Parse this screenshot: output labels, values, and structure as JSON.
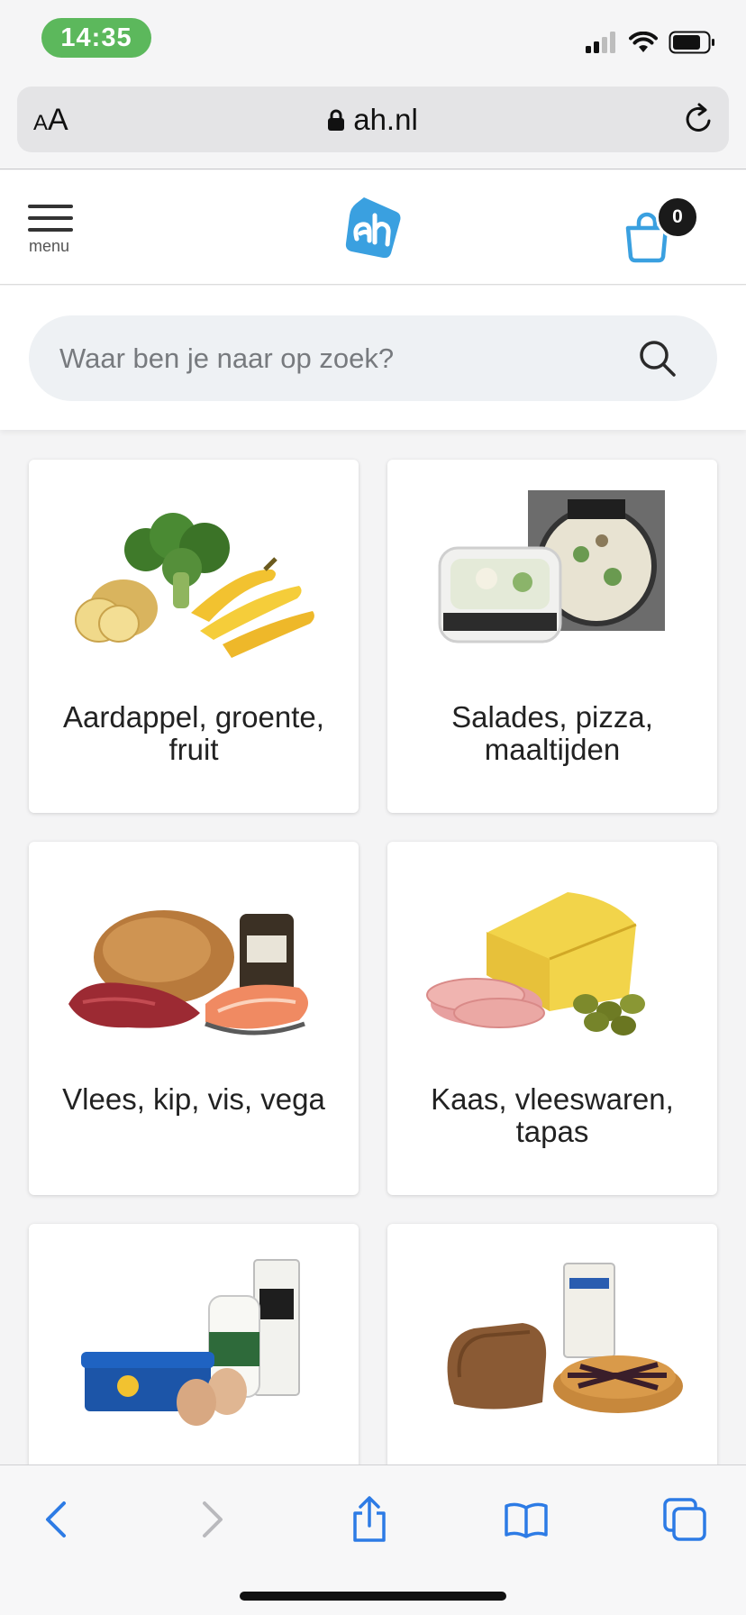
{
  "status_bar": {
    "time": "14:35",
    "icons": [
      "cellular-signal-icon",
      "wifi-icon",
      "battery-icon"
    ]
  },
  "browser": {
    "text_size_label_small": "A",
    "text_size_label_large": "A",
    "url": "ah.nl",
    "icons": [
      "lock-icon",
      "reload-icon"
    ]
  },
  "header": {
    "menu_label": "menu",
    "logo": "albert-heijn-logo",
    "cart_count": "0",
    "brand_color": "#3aa0e0"
  },
  "search": {
    "placeholder": "Waar ben je naar op zoek?"
  },
  "categories": [
    {
      "title": "Aardappel, groente, fruit",
      "image": "potatoes-broccoli-bananas"
    },
    {
      "title": "Salades, pizza, maaltijden",
      "image": "salad-and-pizza-packages"
    },
    {
      "title": "Vlees, kip, vis, vega",
      "image": "chicken-beef-salmon"
    },
    {
      "title": "Kaas, vleeswaren, tapas",
      "image": "cheese-ham-olives"
    },
    {
      "title": "",
      "image": "butter-yoghurt-oatmilk-eggs"
    },
    {
      "title": "",
      "image": "bread-pancake-mix-pie"
    }
  ],
  "toolbar": {
    "items": [
      "back-icon",
      "forward-icon",
      "share-icon",
      "bookmarks-icon",
      "tabs-icon"
    ]
  }
}
